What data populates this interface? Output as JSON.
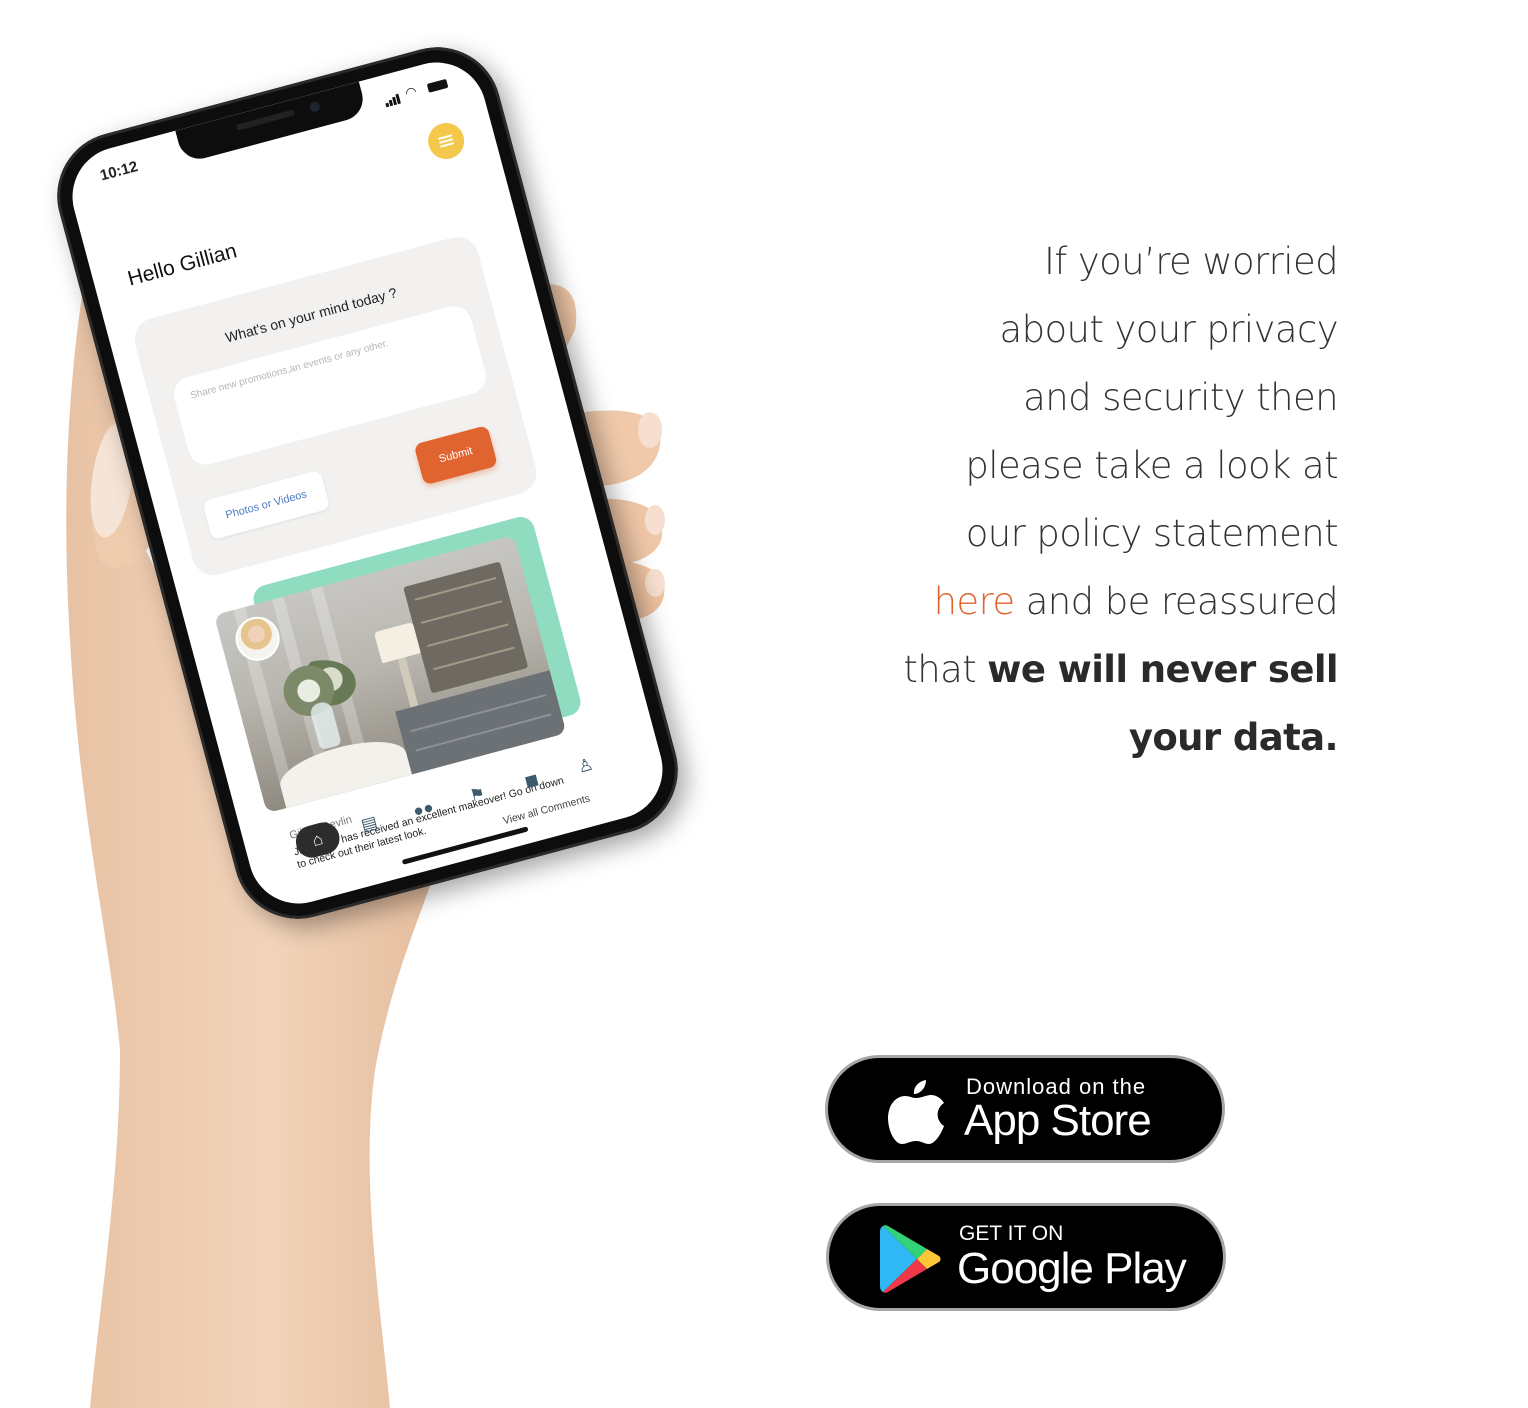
{
  "phone": {
    "status_time": "10:12",
    "greeting": "Hello Gillian",
    "post": {
      "question": "What's on your mind today ?",
      "placeholder": "Share new promotions,an events or any other.",
      "photos_button": "Photos or Videos",
      "submit_button": "Submit"
    },
    "feed": {
      "author": "Gillian Devlin",
      "caption": "Jas Salon has received an excellent makeover! Go on down to check out their latest look.",
      "view_comments": "View all Comments"
    },
    "tabbar": [
      "home-icon",
      "store-icon",
      "groups-icon",
      "flag-icon",
      "bag-icon",
      "profile-icon"
    ]
  },
  "privacy": {
    "line1": "If you’re worried",
    "line2": "about your privacy",
    "line3": "and security then",
    "line4": "please take a look at",
    "line5": "our policy statement",
    "link_text": "here",
    "line6_rest": " and be reassured",
    "line7_prefix": "that ",
    "line7_bold": "we will never sell",
    "line8_bold": "your data.",
    "link_color": "#e0642f"
  },
  "badges": {
    "apple": {
      "small": "Download on the",
      "big": "App Store",
      "icon": "apple-icon"
    },
    "google": {
      "small": "GET IT ON",
      "big": "Google Play",
      "icon": "google-play-icon"
    }
  },
  "colors": {
    "accent": "#e0642f",
    "menu": "#f3c84b",
    "photo_accent": "#8fdcc0",
    "text": "#333333"
  }
}
